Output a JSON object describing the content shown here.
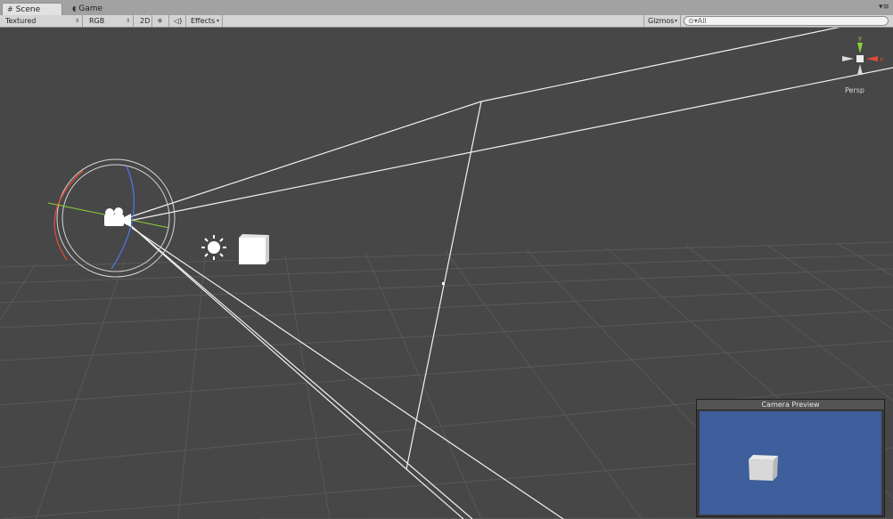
{
  "tabs": [
    {
      "label": "Scene",
      "icon": "grid-icon",
      "active": true
    },
    {
      "label": "Game",
      "icon": "pacman-icon",
      "active": false
    }
  ],
  "tab_menu": "▾≡",
  "toolbar": {
    "shading_mode": "Textured",
    "render_mode": "RGB",
    "mode_2d": "2D",
    "lighting_icon": "sun-icon",
    "audio_icon": "speaker-icon",
    "effects": "Effects",
    "gizmos": "Gizmos",
    "search_placeholder": "All"
  },
  "scene_gizmo": {
    "y_label": "y",
    "x_label": "x",
    "projection": "Persp"
  },
  "camera_preview": {
    "title": "Camera Preview"
  },
  "colors": {
    "scene_bg": "#474747",
    "grid": "#5d5d5d",
    "preview_bg": "#3e5e9c",
    "x_axis": "#e04a3a",
    "y_axis": "#8fcf3a",
    "z_axis": "#4a76e0"
  }
}
